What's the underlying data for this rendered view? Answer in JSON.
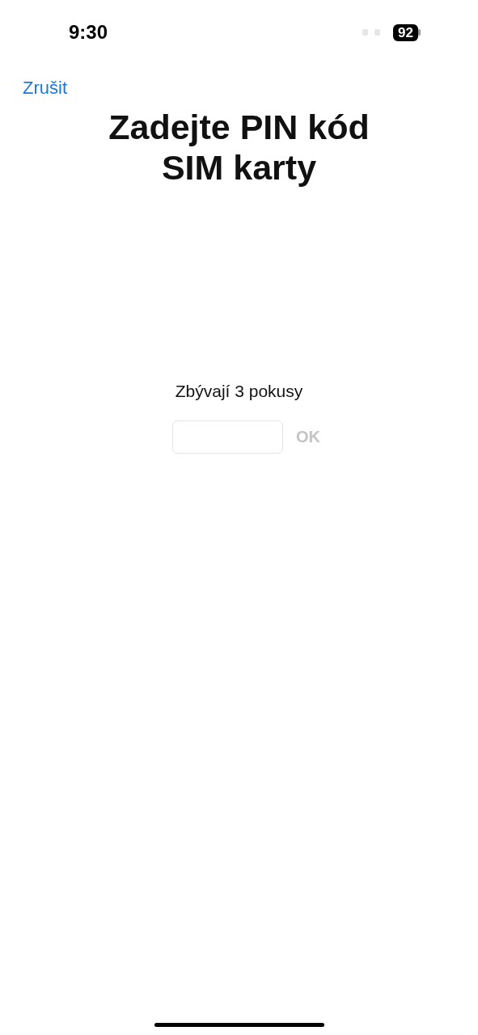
{
  "status_bar": {
    "time": "9:30",
    "battery": "92"
  },
  "nav": {
    "cancel": "Zrušit"
  },
  "title": "Zadejte PIN kód SIM karty",
  "attempts": "Zbývají 3 pokusy",
  "ok_button": {
    "label": "OK",
    "disabled": true
  }
}
